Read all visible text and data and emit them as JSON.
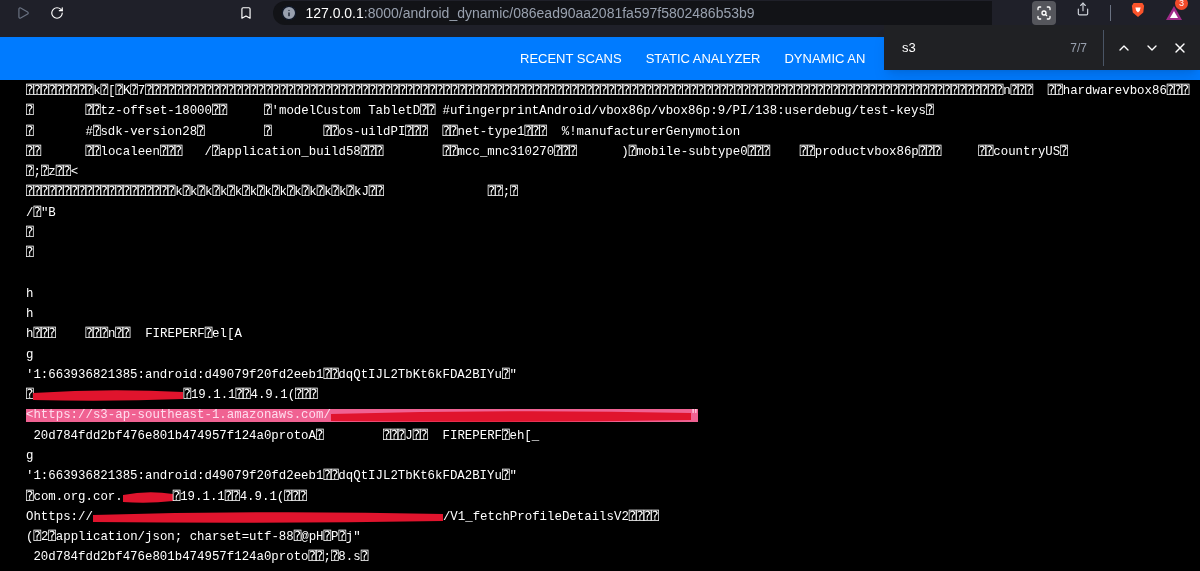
{
  "browser": {
    "url": {
      "host": "127.0.0.1",
      "rest": ":8000/android_dynamic/086ead90aa2081fa597f5802486b53b9"
    },
    "extension_badge": "3"
  },
  "nav": {
    "items": [
      "RECENT SCANS",
      "STATIC ANALYZER",
      "DYNAMIC AN"
    ]
  },
  "find_bar": {
    "query": "s3",
    "count": "7/7"
  },
  "lines_top": [
    {
      "segments": [
        {
          "text": "⍰⍰⍰⍰⍰⍰⍰⍰⍰k⍰[⍰K⍰7⍰⍰⍰⍰⍰⍰⍰⍰⍰⍰⍰⍰⍰⍰⍰⍰⍰⍰⍰⍰⍰⍰⍰⍰⍰⍰⍰⍰⍰⍰⍰⍰⍰⍰⍰⍰⍰⍰⍰⍰⍰⍰⍰⍰⍰⍰⍰⍰⍰⍰⍰⍰⍰⍰⍰⍰⍰⍰⍰⍰⍰⍰⍰⍰⍰⍰⍰⍰⍰⍰⍰⍰⍰⍰⍰⍰⍰⍰⍰⍰⍰⍰⍰⍰⍰⍰⍰⍰⍰⍰⍰⍰⍰⍰⍰⍰⍰⍰⍰⍰⍰⍰⍰⍰⍰⍰⍰⍰⍰⍰⍰⍰⍰⍰⍰n⍰⍰⍰  ⍰⍰hardwarevbox86⍰⍰⍰"
        }
      ]
    },
    {
      "segments": [
        {
          "text": "⍰       ⍰⍰tz-offset-18000⍰⍰     ⍰'modelCustom TabletD⍰⍰ #ufingerprintAndroid/vbox86p/vbox86p:9/PI/138:userdebug/test-keys⍰"
        }
      ]
    },
    {
      "segments": [
        {
          "text": "⍰       #⍰sdk-version28⍰        ⍰       ⍰⍰os-uildPI⍰⍰⍰  ⍰⍰net-type1⍰⍰⍰  %!manufacturerGenymotion"
        }
      ]
    },
    {
      "segments": [
        {
          "text": "⍰⍰      ⍰⍰localeen⍰⍰⍰   /⍰application_build58⍰⍰⍰        ⍰⍰mcc_mnc310270⍰⍰⍰      )⍰mobile-subtype0⍰⍰⍰    ⍰⍰productvbox86p⍰⍰⍰     ⍰⍰countryUS⍰"
        }
      ]
    },
    {
      "segments": [
        {
          "text": "⍰;⍰z⍰⍰<"
        }
      ]
    },
    {
      "segments": [
        {
          "text": "⍰⍰⍰⍰⍰⍰⍰⍰⍰⍰⍰⍰⍰⍰⍰⍰⍰⍰⍰⍰k⍰k⍰k⍰k⍰k⍰k⍰k⍰k⍰k⍰k⍰k⍰k⍰kJ⍰⍰              ⍰⍰;⍰"
        }
      ]
    },
    {
      "segments": [
        {
          "text": "/⍰\"B"
        }
      ]
    },
    {
      "segments": [
        {
          "text": "⍰"
        }
      ]
    },
    {
      "segments": [
        {
          "text": "⍰"
        }
      ]
    }
  ],
  "lines_bottom": [
    {
      "segments": [
        {
          "text": "h"
        }
      ]
    },
    {
      "segments": [
        {
          "text": "h"
        }
      ]
    },
    {
      "segments": [
        {
          "text": "h⍰⍰⍰    ⍰⍰⍰n⍰⍰  FIREPERF⍰el[A"
        }
      ]
    },
    {
      "segments": [
        {
          "text": "g"
        }
      ]
    },
    {
      "segments": [
        {
          "text": "'1:663936821385:android:d49079f20fd2eeb1⍰⍰dqQtIJL2TbKt6kFDA2BIYu⍰\""
        }
      ]
    },
    {
      "segments": [
        {
          "text": "⍰"
        },
        {
          "kind": "redaction"
        },
        {
          "text": "⍰19.1.1⍰⍰4.9.1(⍰⍰⍰"
        }
      ]
    },
    {
      "highlighted": true,
      "segments": [
        {
          "text": "<https://s3-ap-southeast-1.amazonaws.com/"
        },
        {
          "kind": "redaction"
        },
        {
          "text": "\""
        }
      ]
    },
    {
      "segments": [
        {
          "text": " 20d784fdd2bf476e801b474957f124a0protoA⍰        ⍰⍰⍰J⍰⍰  FIREPERF⍰eh[_"
        }
      ]
    },
    {
      "segments": [
        {
          "text": "g"
        }
      ]
    },
    {
      "segments": [
        {
          "text": "'1:663936821385:android:d49079f20fd2eeb1⍰⍰dqQtIJL2TbKt6kFDA2BIYu⍰\""
        }
      ]
    },
    {
      "segments": [
        {
          "text": "⍰com.org.cor."
        },
        {
          "kind": "redaction"
        },
        {
          "text": "⍰19.1.1⍰⍰4.9.1(⍰⍰⍰"
        }
      ]
    },
    {
      "segments": [
        {
          "text": "Ohttps://"
        },
        {
          "kind": "redaction"
        },
        {
          "text": "/V1_fetchProfileDetailsV2⍰⍰⍰⍰"
        }
      ]
    },
    {
      "segments": [
        {
          "text": "(⍰2⍰application/json; charset=utf-88⍰@pH⍰P⍰j\""
        }
      ]
    },
    {
      "segments": [
        {
          "text": " 20d784fdd2bf476e801b474957f124a0proto⍰⍰;⍰8.s⍰"
        }
      ]
    }
  ]
}
